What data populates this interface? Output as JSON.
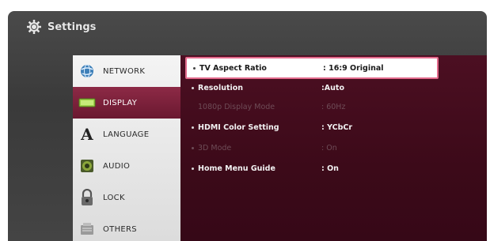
{
  "header": {
    "title": "Settings",
    "icon": "gear-icon"
  },
  "sidebar": {
    "items": [
      {
        "label": "NETWORK",
        "icon": "network-globe-icon",
        "active": false
      },
      {
        "label": "DISPLAY",
        "icon": "display-screen-icon",
        "active": true
      },
      {
        "label": "LANGUAGE",
        "icon": "letter-a-icon",
        "active": false
      },
      {
        "label": "AUDIO",
        "icon": "speaker-icon",
        "active": false
      },
      {
        "label": "LOCK",
        "icon": "padlock-icon",
        "active": false
      },
      {
        "label": "OTHERS",
        "icon": "others-icon",
        "active": false
      }
    ]
  },
  "settings": {
    "rows": [
      {
        "name": "TV Aspect Ratio",
        "value": ": 16:9 Original",
        "state": "selected"
      },
      {
        "name": "Resolution",
        "value": ":Auto",
        "state": "enabled"
      },
      {
        "name": "1080p Display Mode",
        "value": ": 60Hz",
        "state": "disabled"
      },
      {
        "name": "HDMI Color Setting",
        "value": ": YCbCr",
        "state": "enabled"
      },
      {
        "name": "3D Mode",
        "value": ": On",
        "state": "disabled"
      },
      {
        "name": "Home Menu Guide",
        "value": ": On",
        "state": "enabled"
      }
    ]
  },
  "colors": {
    "accent_selected_border": "#e36a8c",
    "sidebar_active": "#7a2038",
    "panel_bg": "#420c1d"
  }
}
